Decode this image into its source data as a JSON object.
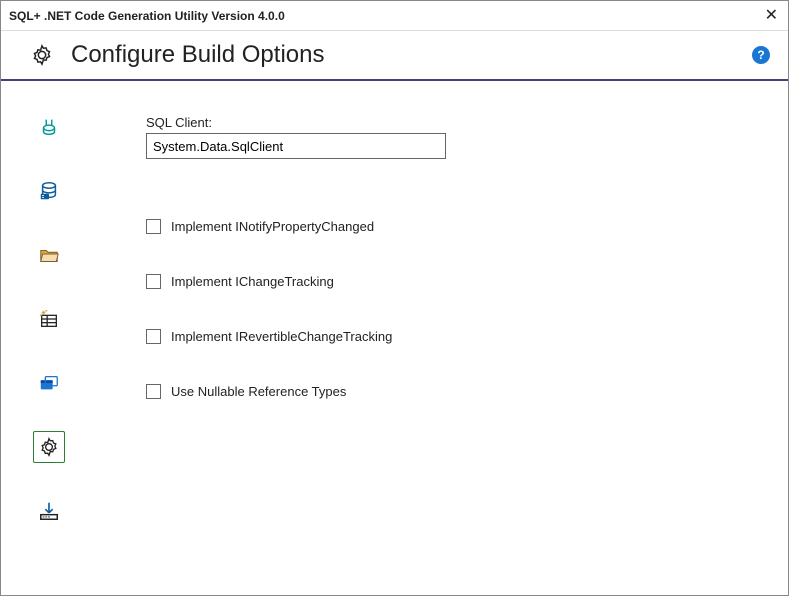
{
  "window": {
    "title": "SQL+ .NET Code Generation Utility Version 4.0.0"
  },
  "header": {
    "title": "Configure Build Options"
  },
  "form": {
    "sqlClientLabel": "SQL Client:",
    "sqlClientValue": "System.Data.SqlClient"
  },
  "checks": {
    "notifyProp": "Implement INotifyPropertyChanged",
    "changeTrack": "Implement IChangeTracking",
    "revertChangeTrack": "Implement IRevertibleChangeTracking",
    "nullableRef": "Use Nullable Reference Types"
  }
}
